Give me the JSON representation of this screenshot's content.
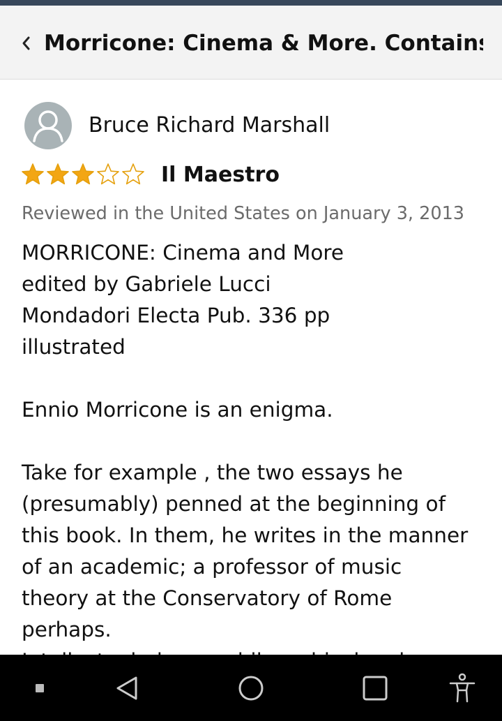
{
  "header": {
    "title": "Morricone: Cinema & More. Contains ..."
  },
  "review": {
    "reviewer_name": "Bruce Richard Marshall",
    "rating": 3,
    "rating_max": 5,
    "title": "Il Maestro",
    "date_line": "Reviewed in the United States on January 3, 2013",
    "body": [
      "MORRICONE: Cinema and More",
      "edited by Gabriele Lucci",
      "Mondadori Electa Pub. 336 pp",
      "illustrated",
      "",
      "Ennio Morricone is an enigma.",
      "",
      "Take for example , the two essays he",
      "(presumably) penned at the beginning of",
      "this book. In them, he writes in the manner",
      "of an academic; a professor of music",
      "theory at the Conservatory of Rome",
      "perhaps.",
      "Intellectual, dense, philosophical and"
    ]
  },
  "colors": {
    "star_fill": "#f3a614",
    "star_outline": "#e5a00d",
    "header_bg": "#f3f3f3",
    "status_strip": "#37475a"
  },
  "icons": {
    "back": "chevron-left-icon",
    "avatar": "user-avatar-icon",
    "nav_recents_dot": "square-dot-icon",
    "nav_back": "triangle-back-icon",
    "nav_home": "circle-home-icon",
    "nav_overview": "square-overview-icon",
    "nav_accessibility": "accessibility-icon"
  }
}
